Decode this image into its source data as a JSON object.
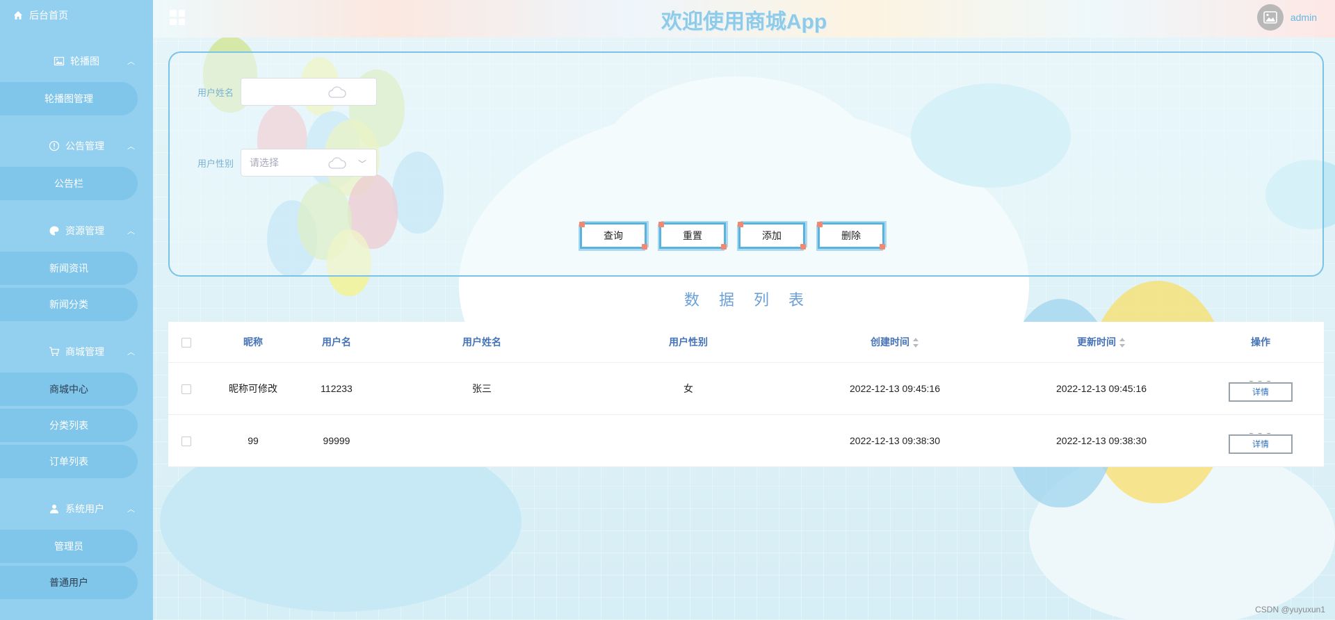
{
  "header": {
    "title": "欢迎使用商城App",
    "username": "admin"
  },
  "sidebar": {
    "home": "后台首页",
    "groups": [
      {
        "label": "轮播图",
        "items": [
          "轮播图管理"
        ]
      },
      {
        "label": "公告管理",
        "items": [
          "公告栏"
        ]
      },
      {
        "label": "资源管理",
        "items": [
          "新闻资讯",
          "新闻分类"
        ]
      },
      {
        "label": "商城管理",
        "items": [
          "商城中心",
          "分类列表",
          "订单列表"
        ]
      },
      {
        "label": "系统用户",
        "items": [
          "管理员",
          "普通用户"
        ]
      }
    ]
  },
  "search": {
    "name_label": "用户姓名",
    "name_value": "",
    "gender_label": "用户性别",
    "gender_placeholder": "请选择",
    "buttons": {
      "query": "查询",
      "reset": "重置",
      "add": "添加",
      "delete": "删除"
    }
  },
  "list": {
    "title": "数据列表",
    "columns": [
      "昵称",
      "用户名",
      "用户姓名",
      "用户性别",
      "创建时间",
      "更新时间",
      "操作"
    ],
    "rows": [
      {
        "nickname": "昵称可修改",
        "username": "112233",
        "realname": "张三",
        "gender": "女",
        "created": "2022-12-13 09:45:16",
        "updated": "2022-12-13 09:45:16",
        "action": "详情"
      },
      {
        "nickname": "99",
        "username": "99999",
        "realname": "",
        "gender": "",
        "created": "2022-12-13 09:38:30",
        "updated": "2022-12-13 09:38:30",
        "action": "详情"
      }
    ]
  },
  "watermark": "CSDN @yuyuxun1",
  "colors": {
    "sidebar": "#93cfef",
    "sidebar_item": "#80c6ea",
    "accent": "#5ab3de",
    "title": "#8fcbe8"
  }
}
